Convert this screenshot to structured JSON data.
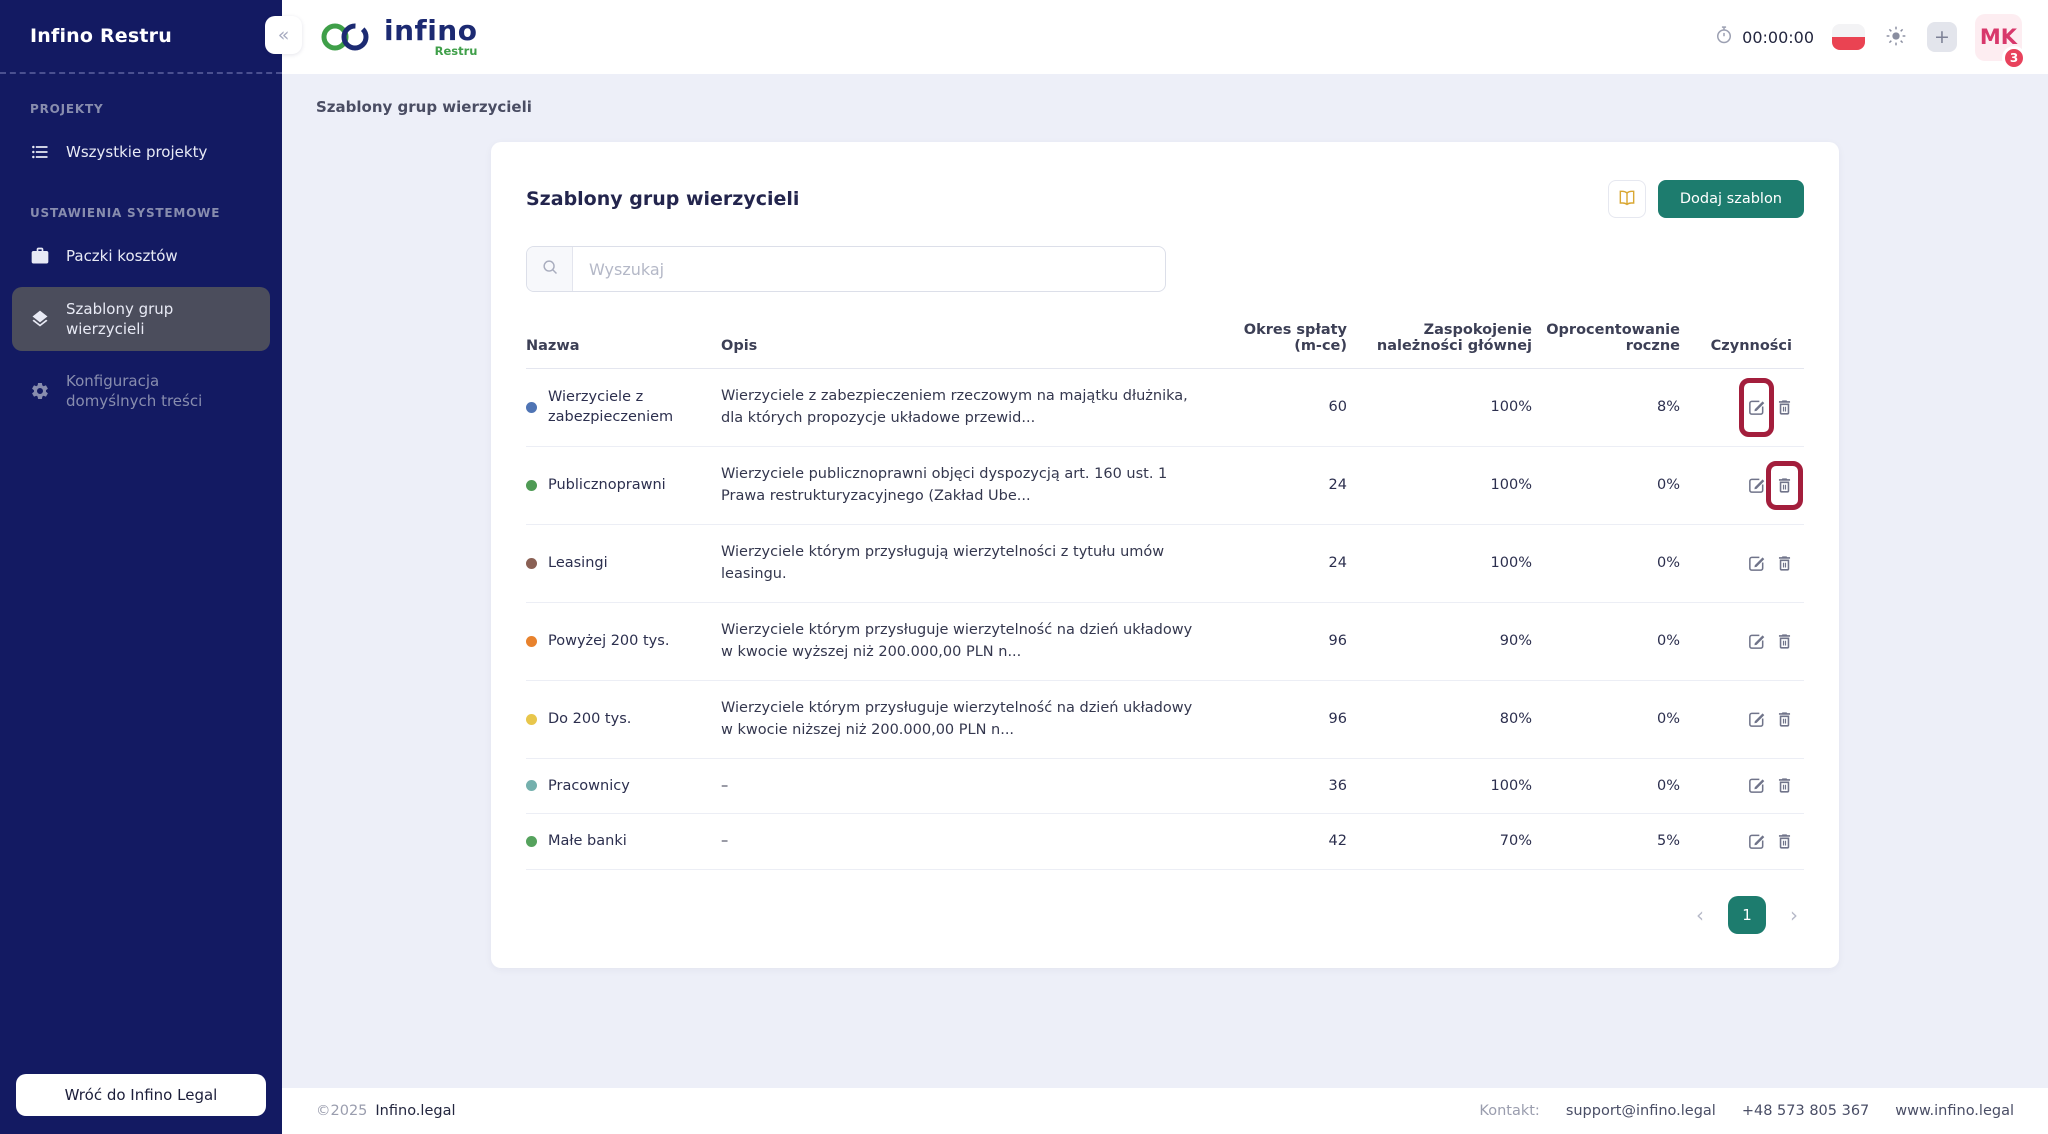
{
  "sidebar": {
    "title": "Infino Restru",
    "sections": [
      {
        "label": "PROJEKTY",
        "items": [
          {
            "label": "Wszystkie projekty",
            "icon": "list-icon",
            "active": false
          }
        ]
      },
      {
        "label": "USTAWIENIA SYSTEMOWE",
        "items": [
          {
            "label": "Paczki kosztów",
            "icon": "briefcase-icon",
            "active": false
          },
          {
            "label": "Szablony grup wierzycieli",
            "icon": "layers-icon",
            "active": true
          },
          {
            "label": "Konfiguracja domyślnych treści",
            "icon": "gear-icon",
            "active": false
          }
        ]
      }
    ],
    "back_button": "Wróć do Infino Legal",
    "collapse_glyph": "«"
  },
  "topbar": {
    "brand": {
      "name": "infino",
      "sub": "Restru"
    },
    "timer": "00:00:00",
    "plus_glyph": "+",
    "avatar": {
      "initials": "MK",
      "badge": "3"
    }
  },
  "breadcrumb": "Szablony grup wierzycieli",
  "main": {
    "card_title": "Szablony grup wierzycieli",
    "add_button": "Dodaj szablon",
    "search_placeholder": "Wyszukaj",
    "table": {
      "columns": [
        "Nazwa",
        "Opis",
        "Okres spłaty (m-ce)",
        "Zaspokojenie należności głównej",
        "Oprocentowanie roczne",
        "Czynności"
      ],
      "rows": [
        {
          "name": "Wierzyciele z zabezpieczeniem",
          "dot": "#4f74b4",
          "desc": "Wierzyciele z zabezpieczeniem rzeczowym na majątku dłużnika, dla których propozycje układowe przewid...",
          "okres": "60",
          "zaspokojenie": "100%",
          "oprocentowanie": "8%",
          "highlight": "edit"
        },
        {
          "name": "Publicznoprawni",
          "dot": "#4f9b55",
          "desc": "Wierzyciele publicznoprawni objęci dyspozycją art. 160 ust. 1 Prawa restrukturyzacyjnego (Zakład Ube...",
          "okres": "24",
          "zaspokojenie": "100%",
          "oprocentowanie": "0%",
          "highlight": "delete"
        },
        {
          "name": "Leasingi",
          "dot": "#8a6054",
          "desc": "Wierzyciele którym przysługują wierzytelności z tytułu umów leasingu.",
          "okres": "24",
          "zaspokojenie": "100%",
          "oprocentowanie": "0%",
          "highlight": ""
        },
        {
          "name": "Powyżej 200 tys.",
          "dot": "#e8822d",
          "desc": "Wierzyciele którym przysługuje wierzytelność na dzień układowy w kwocie wyższej niż 200.000,00 PLN n...",
          "okres": "96",
          "zaspokojenie": "90%",
          "oprocentowanie": "0%",
          "highlight": ""
        },
        {
          "name": "Do 200 tys.",
          "dot": "#e8c64b",
          "desc": "Wierzyciele którym przysługuje wierzytelność na dzień układowy w kwocie niższej niż 200.000,00 PLN n...",
          "okres": "96",
          "zaspokojenie": "80%",
          "oprocentowanie": "0%",
          "highlight": ""
        },
        {
          "name": "Pracownicy",
          "dot": "#74b0ad",
          "desc": "–",
          "okres": "36",
          "zaspokojenie": "100%",
          "oprocentowanie": "0%",
          "highlight": ""
        },
        {
          "name": "Małe banki",
          "dot": "#55a25d",
          "desc": "–",
          "okres": "42",
          "zaspokojenie": "70%",
          "oprocentowanie": "5%",
          "highlight": ""
        }
      ]
    },
    "pagination": {
      "prev_glyph": "‹",
      "current": "1",
      "next_glyph": "›"
    }
  },
  "footer": {
    "copyright": "©2025",
    "brand": "Infino.legal",
    "contact_label": "Kontakt:",
    "email": "support@infino.legal",
    "phone": "+48 573 805 367",
    "website": "www.infino.legal"
  },
  "colors": {
    "sidebar_bg": "#131a62",
    "accent_teal": "#1d7c6e",
    "annotation_red": "#a31e3c",
    "badge_red": "#e8425c",
    "flag_red": "#ea4352",
    "brand_navy": "#1c2a72",
    "brand_green": "#3f9f49",
    "book_icon_gold": "#d9a733"
  }
}
